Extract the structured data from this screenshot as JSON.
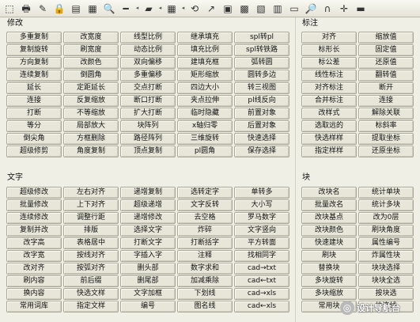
{
  "toolbar": {
    "icons": [
      "selection-icon",
      "print-icon",
      "paint-brush-icon",
      "lock-icon",
      "document-icon",
      "layers-icon",
      "zoom-icon",
      "ruler-icon",
      "arrow-left-icon",
      "hatch-icon",
      "arrow-left-icon",
      "grid-icon",
      "arrow-left-icon",
      "rotate-icon",
      "arrow-up-right-icon",
      "block-icon",
      "color-grid-icon",
      "palette-icon",
      "table-icon",
      "bookmark-icon",
      "search-icon",
      "magnet-icon",
      "crosshair-icon",
      "folder-icon"
    ],
    "glyphs": [
      "⬚",
      "🖶",
      "✎",
      "🔒",
      "▤",
      "▦",
      "🔍",
      "━",
      "◂",
      "▰",
      "◂",
      "▦",
      "◂",
      "⟲",
      "↗",
      "▣",
      "▩",
      "▧",
      "▥",
      "▭",
      "🔎",
      "∩",
      "✛",
      "▬"
    ]
  },
  "sections": {
    "modify": {
      "title": "修改",
      "buttons": [
        "多重复制",
        "改宽度",
        "线型比例",
        "继承填充",
        "spl转pl",
        "复制旋转",
        "刷宽度",
        "动态比例",
        "填充比例",
        "spl转铁路",
        "方向复制",
        "改颜色",
        "双向偏移",
        "建填充框",
        "弧转圆",
        "连续复制",
        "倒圆角",
        "多重偏移",
        "矩形缩放",
        "圆转多边",
        "延长",
        "定距延长",
        "交点打断",
        "四边大小",
        "转三视图",
        "连接",
        "反复缩放",
        "断口打断",
        "夹点拉伸",
        "pl线反向",
        "打断",
        "不等缩放",
        "扩大打断",
        "临时隐藏",
        "前置对象",
        "等分",
        "局部放大",
        "块阵列",
        "x轴归零",
        "后置对象",
        "倒尖角",
        "方框删除",
        "路径阵列",
        "三维旋转",
        "快速选择",
        "超级修剪",
        "角度复制",
        "顶点复制",
        "pl圆角",
        "保存选择"
      ]
    },
    "text": {
      "title": "文字",
      "buttons": [
        "超级修改",
        "左右对齐",
        "递增复制",
        "选转定字",
        "单转多",
        "批量修改",
        "上下对齐",
        "超级递增",
        "文字反转",
        "大小写",
        "连续修改",
        "调整行距",
        "递增修改",
        "去空格",
        "罗马数字",
        "复制并改",
        "排版",
        "选择文字",
        "炸碎",
        "文字竖向",
        "改字高",
        "表格居中",
        "打断文字",
        "打断括字",
        "平方转面",
        "改字宽",
        "按线对齐",
        "字插入字",
        "注释",
        "找相同字",
        "改对齐",
        "按弧对齐",
        "删头部",
        "数字求和",
        "cad→txt",
        "刷内容",
        "前后缀",
        "删尾部",
        "加减乘除",
        "cad←txt",
        "换内容",
        "快选文样",
        "文字加框",
        "下划线",
        "cad→xls",
        "常用词库",
        "指定文样",
        "编号",
        "图名线",
        "cad←xls"
      ]
    },
    "dimension": {
      "title": "标注",
      "buttons": [
        "对齐",
        "缩放值",
        "标形长",
        "固定值",
        "标公差",
        "还原值",
        "线性标注",
        "翻转值",
        "对齐标注",
        "断开",
        "合并标注",
        "连接",
        "改样式",
        "解除关联",
        "选取远的",
        "标斜率",
        "快选样样",
        "提取坐标",
        "指定样样",
        "还原坐标"
      ]
    },
    "block": {
      "title": "块",
      "buttons": [
        "改块名",
        "统计单块",
        "批量改名",
        "统计多块",
        "改块基点",
        "改为0层",
        "改块颜色",
        "刷块角度",
        "快速建块",
        "属性编号",
        "刷块",
        "炸属性块",
        "替换块",
        "块块选择",
        "多块旋转",
        "块块全选",
        "多块缩放",
        "按块选",
        "常用块",
        "块连线"
      ]
    }
  },
  "watermark": {
    "icon": "watermark-logo-icon",
    "text": "设计导航台"
  }
}
